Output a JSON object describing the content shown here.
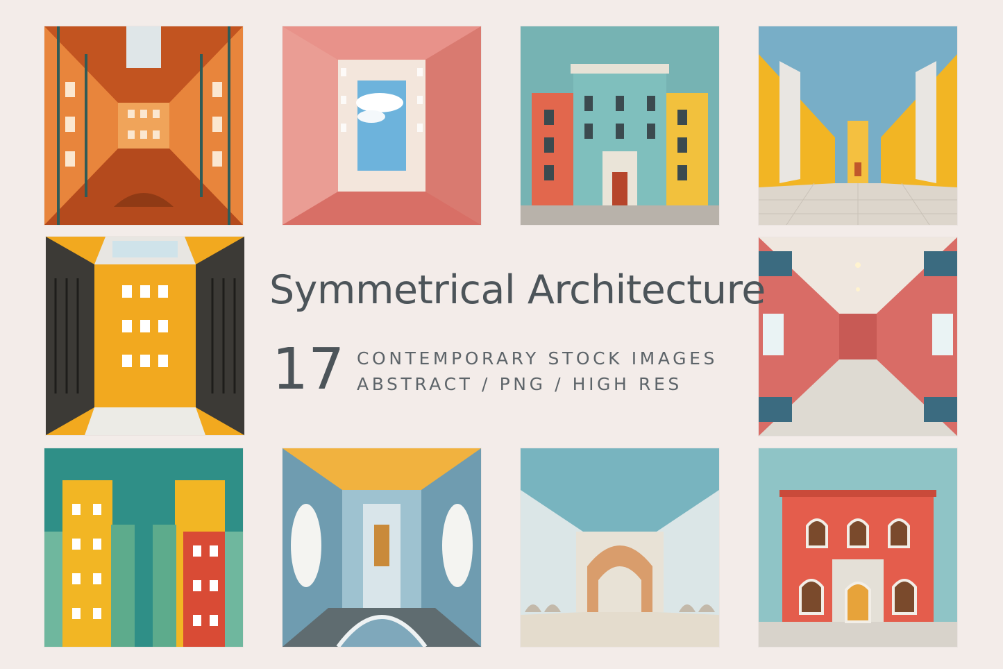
{
  "title": "Symmetrical Architecture",
  "count": "17",
  "subtitle_line1": "CONTEMPORARY STOCK IMAGES",
  "subtitle_line2": "ABSTRACT / PNG / HIGH RES",
  "colors": {
    "background": "#f3ece9",
    "text": "#4c5459"
  }
}
